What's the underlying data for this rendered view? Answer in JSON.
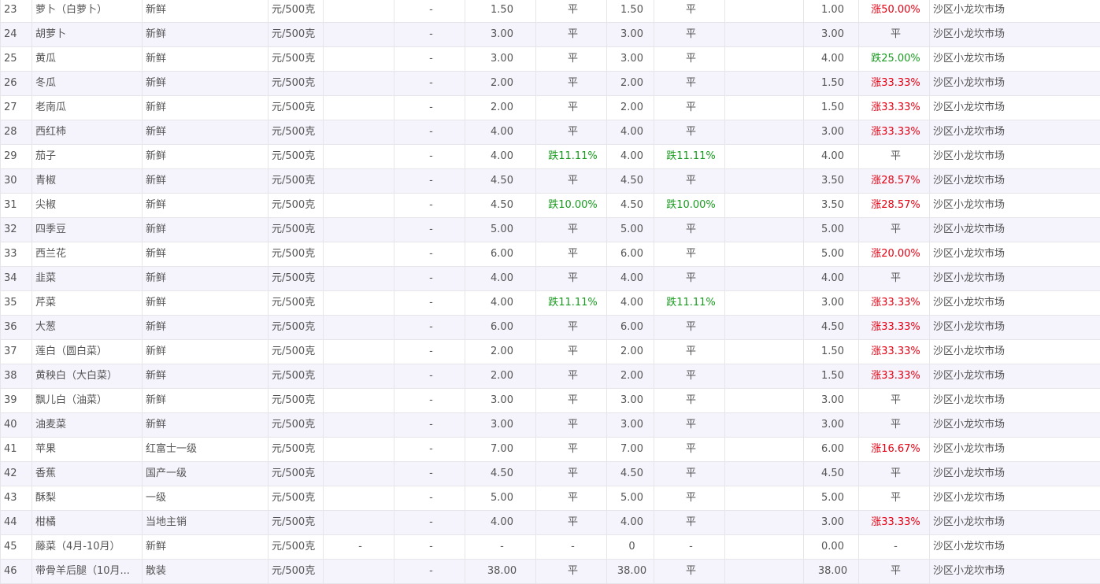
{
  "colors": {
    "rise": "#e60012",
    "fall": "#199b1f",
    "flat": "#555555",
    "stripe": "#f5f3fb"
  },
  "rows": [
    {
      "no": "23",
      "name": "萝卜（白萝卜）",
      "spec": "新鲜",
      "unit": "元/500克",
      "c4": "",
      "c5": "-",
      "p1": "1.50",
      "ch1": "平",
      "p2": "1.50",
      "ch2": "平",
      "c10": "",
      "p3": "1.00",
      "ch3": "涨50.00%",
      "market": "沙区小龙坎市场"
    },
    {
      "no": "24",
      "name": "胡萝卜",
      "spec": "新鲜",
      "unit": "元/500克",
      "c4": "",
      "c5": "-",
      "p1": "3.00",
      "ch1": "平",
      "p2": "3.00",
      "ch2": "平",
      "c10": "",
      "p3": "3.00",
      "ch3": "平",
      "market": "沙区小龙坎市场"
    },
    {
      "no": "25",
      "name": "黄瓜",
      "spec": "新鲜",
      "unit": "元/500克",
      "c4": "",
      "c5": "-",
      "p1": "3.00",
      "ch1": "平",
      "p2": "3.00",
      "ch2": "平",
      "c10": "",
      "p3": "4.00",
      "ch3": "跌25.00%",
      "market": "沙区小龙坎市场"
    },
    {
      "no": "26",
      "name": "冬瓜",
      "spec": "新鲜",
      "unit": "元/500克",
      "c4": "",
      "c5": "-",
      "p1": "2.00",
      "ch1": "平",
      "p2": "2.00",
      "ch2": "平",
      "c10": "",
      "p3": "1.50",
      "ch3": "涨33.33%",
      "market": "沙区小龙坎市场"
    },
    {
      "no": "27",
      "name": "老南瓜",
      "spec": "新鲜",
      "unit": "元/500克",
      "c4": "",
      "c5": "-",
      "p1": "2.00",
      "ch1": "平",
      "p2": "2.00",
      "ch2": "平",
      "c10": "",
      "p3": "1.50",
      "ch3": "涨33.33%",
      "market": "沙区小龙坎市场"
    },
    {
      "no": "28",
      "name": "西红柿",
      "spec": "新鲜",
      "unit": "元/500克",
      "c4": "",
      "c5": "-",
      "p1": "4.00",
      "ch1": "平",
      "p2": "4.00",
      "ch2": "平",
      "c10": "",
      "p3": "3.00",
      "ch3": "涨33.33%",
      "market": "沙区小龙坎市场"
    },
    {
      "no": "29",
      "name": "茄子",
      "spec": "新鲜",
      "unit": "元/500克",
      "c4": "",
      "c5": "-",
      "p1": "4.00",
      "ch1": "跌11.11%",
      "p2": "4.00",
      "ch2": "跌11.11%",
      "c10": "",
      "p3": "4.00",
      "ch3": "平",
      "market": "沙区小龙坎市场"
    },
    {
      "no": "30",
      "name": "青椒",
      "spec": "新鲜",
      "unit": "元/500克",
      "c4": "",
      "c5": "-",
      "p1": "4.50",
      "ch1": "平",
      "p2": "4.50",
      "ch2": "平",
      "c10": "",
      "p3": "3.50",
      "ch3": "涨28.57%",
      "market": "沙区小龙坎市场"
    },
    {
      "no": "31",
      "name": "尖椒",
      "spec": "新鲜",
      "unit": "元/500克",
      "c4": "",
      "c5": "-",
      "p1": "4.50",
      "ch1": "跌10.00%",
      "p2": "4.50",
      "ch2": "跌10.00%",
      "c10": "",
      "p3": "3.50",
      "ch3": "涨28.57%",
      "market": "沙区小龙坎市场"
    },
    {
      "no": "32",
      "name": "四季豆",
      "spec": "新鲜",
      "unit": "元/500克",
      "c4": "",
      "c5": "-",
      "p1": "5.00",
      "ch1": "平",
      "p2": "5.00",
      "ch2": "平",
      "c10": "",
      "p3": "5.00",
      "ch3": "平",
      "market": "沙区小龙坎市场"
    },
    {
      "no": "33",
      "name": "西兰花",
      "spec": "新鲜",
      "unit": "元/500克",
      "c4": "",
      "c5": "-",
      "p1": "6.00",
      "ch1": "平",
      "p2": "6.00",
      "ch2": "平",
      "c10": "",
      "p3": "5.00",
      "ch3": "涨20.00%",
      "market": "沙区小龙坎市场"
    },
    {
      "no": "34",
      "name": "韭菜",
      "spec": "新鲜",
      "unit": "元/500克",
      "c4": "",
      "c5": "-",
      "p1": "4.00",
      "ch1": "平",
      "p2": "4.00",
      "ch2": "平",
      "c10": "",
      "p3": "4.00",
      "ch3": "平",
      "market": "沙区小龙坎市场"
    },
    {
      "no": "35",
      "name": "芹菜",
      "spec": "新鲜",
      "unit": "元/500克",
      "c4": "",
      "c5": "-",
      "p1": "4.00",
      "ch1": "跌11.11%",
      "p2": "4.00",
      "ch2": "跌11.11%",
      "c10": "",
      "p3": "3.00",
      "ch3": "涨33.33%",
      "market": "沙区小龙坎市场"
    },
    {
      "no": "36",
      "name": "大葱",
      "spec": "新鲜",
      "unit": "元/500克",
      "c4": "",
      "c5": "-",
      "p1": "6.00",
      "ch1": "平",
      "p2": "6.00",
      "ch2": "平",
      "c10": "",
      "p3": "4.50",
      "ch3": "涨33.33%",
      "market": "沙区小龙坎市场"
    },
    {
      "no": "37",
      "name": "莲白（圆白菜）",
      "spec": "新鲜",
      "unit": "元/500克",
      "c4": "",
      "c5": "-",
      "p1": "2.00",
      "ch1": "平",
      "p2": "2.00",
      "ch2": "平",
      "c10": "",
      "p3": "1.50",
      "ch3": "涨33.33%",
      "market": "沙区小龙坎市场"
    },
    {
      "no": "38",
      "name": "黄秧白（大白菜）",
      "spec": "新鲜",
      "unit": "元/500克",
      "c4": "",
      "c5": "-",
      "p1": "2.00",
      "ch1": "平",
      "p2": "2.00",
      "ch2": "平",
      "c10": "",
      "p3": "1.50",
      "ch3": "涨33.33%",
      "market": "沙区小龙坎市场"
    },
    {
      "no": "39",
      "name": "飘儿白（油菜）",
      "spec": "新鲜",
      "unit": "元/500克",
      "c4": "",
      "c5": "-",
      "p1": "3.00",
      "ch1": "平",
      "p2": "3.00",
      "ch2": "平",
      "c10": "",
      "p3": "3.00",
      "ch3": "平",
      "market": "沙区小龙坎市场"
    },
    {
      "no": "40",
      "name": "油麦菜",
      "spec": "新鲜",
      "unit": "元/500克",
      "c4": "",
      "c5": "-",
      "p1": "3.00",
      "ch1": "平",
      "p2": "3.00",
      "ch2": "平",
      "c10": "",
      "p3": "3.00",
      "ch3": "平",
      "market": "沙区小龙坎市场"
    },
    {
      "no": "41",
      "name": "苹果",
      "spec": "红富士一级",
      "unit": "元/500克",
      "c4": "",
      "c5": "-",
      "p1": "7.00",
      "ch1": "平",
      "p2": "7.00",
      "ch2": "平",
      "c10": "",
      "p3": "6.00",
      "ch3": "涨16.67%",
      "market": "沙区小龙坎市场"
    },
    {
      "no": "42",
      "name": "香蕉",
      "spec": "国产一级",
      "unit": "元/500克",
      "c4": "",
      "c5": "-",
      "p1": "4.50",
      "ch1": "平",
      "p2": "4.50",
      "ch2": "平",
      "c10": "",
      "p3": "4.50",
      "ch3": "平",
      "market": "沙区小龙坎市场"
    },
    {
      "no": "43",
      "name": "酥梨",
      "spec": "一级",
      "unit": "元/500克",
      "c4": "",
      "c5": "-",
      "p1": "5.00",
      "ch1": "平",
      "p2": "5.00",
      "ch2": "平",
      "c10": "",
      "p3": "5.00",
      "ch3": "平",
      "market": "沙区小龙坎市场"
    },
    {
      "no": "44",
      "name": "柑橘",
      "spec": "当地主销",
      "unit": "元/500克",
      "c4": "",
      "c5": "-",
      "p1": "4.00",
      "ch1": "平",
      "p2": "4.00",
      "ch2": "平",
      "c10": "",
      "p3": "3.00",
      "ch3": "涨33.33%",
      "market": "沙区小龙坎市场"
    },
    {
      "no": "45",
      "name": "藤菜（4月-10月）",
      "spec": "新鲜",
      "unit": "元/500克",
      "c4": "-",
      "c5": "-",
      "p1": "-",
      "ch1": "-",
      "p2": "0",
      "ch2": "-",
      "c10": "",
      "p3": "0.00",
      "ch3": "-",
      "market": "沙区小龙坎市场"
    },
    {
      "no": "46",
      "name": "带骨羊后腿（10月...",
      "spec": "散装",
      "unit": "元/500克",
      "c4": "",
      "c5": "-",
      "p1": "38.00",
      "ch1": "平",
      "p2": "38.00",
      "ch2": "平",
      "c10": "",
      "p3": "38.00",
      "ch3": "平",
      "market": "沙区小龙坎市场"
    }
  ]
}
